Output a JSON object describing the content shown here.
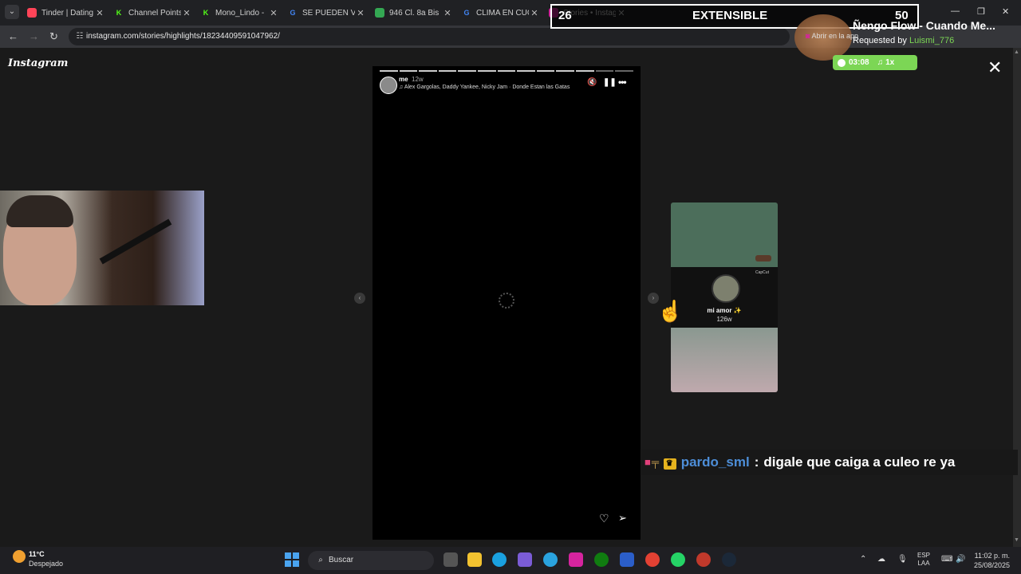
{
  "browser": {
    "tabs": [
      {
        "title": "Tinder | Dating",
        "color": "#ff4458",
        "glyph": ""
      },
      {
        "title": "Channel Points",
        "color": "#53fc18",
        "glyph": "K"
      },
      {
        "title": "Mono_Lindo -",
        "color": "#53fc18",
        "glyph": "K"
      },
      {
        "title": "SE PUEDEN VE",
        "color": "#4285f4",
        "glyph": "G"
      },
      {
        "title": "946 Cl. 8a Bis",
        "color": "#34a853",
        "glyph": ""
      },
      {
        "title": "CLIMA EN CUC",
        "color": "#4285f4",
        "glyph": "G"
      },
      {
        "title": "Stories • Instag",
        "color": "#d6249f",
        "glyph": ""
      }
    ],
    "url": "instagram.com/stories/highlights/18234409591047962/"
  },
  "page": {
    "logo": "Instagram",
    "close": "✕"
  },
  "story": {
    "progress_total": 13,
    "progress_done": 11,
    "username": "me",
    "time": "12w",
    "song": "Alex Gargolas, Daddy Yankee, Nicky Jam · Donde Estan las Gatas"
  },
  "next_story": {
    "name": "mi amor ✨",
    "time": "126w",
    "capcut": "CapCut"
  },
  "overlay": {
    "left_number": "26",
    "title": "EXTENSIBLE",
    "right_number": "50",
    "song_title": "Ñengo Flow - Cuando Me...",
    "requested_by_label": "Requested by",
    "requested_by_user": "Luismi_776",
    "time": "03:08",
    "speed": "1x",
    "abrir": "Abrir en la app"
  },
  "chat": {
    "user": "pardo_sml",
    "message": "digale que caiga a culeo re ya"
  },
  "taskbar": {
    "temp": "11°C",
    "weather": "Despejado",
    "search_placeholder": "Buscar",
    "lang1": "ESP",
    "lang2": "LAA",
    "time": "11:02 p. m.",
    "date": "25/08/2025"
  }
}
